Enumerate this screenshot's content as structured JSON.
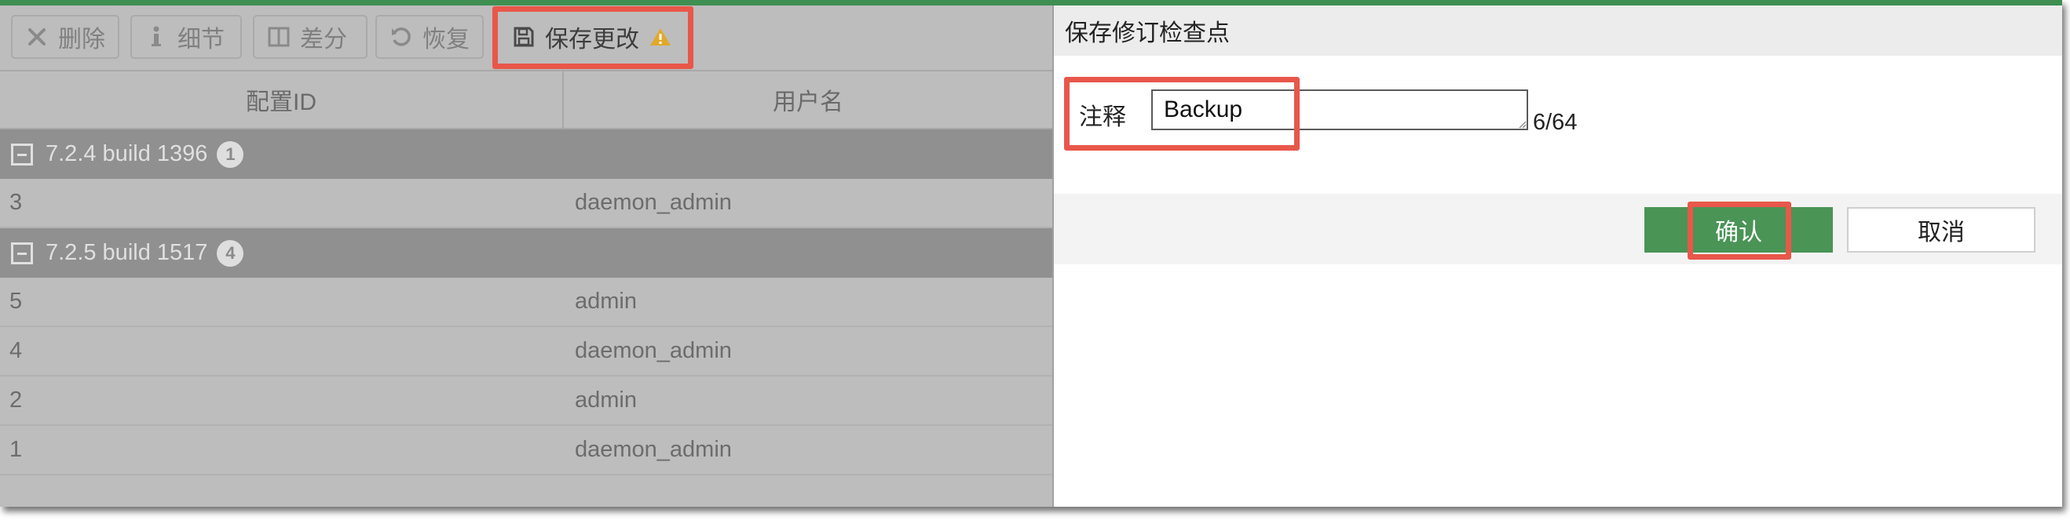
{
  "colors": {
    "accent": "#3f8f52",
    "highlight": "#e8574a",
    "ok_button": "#4a9456",
    "warning": "#e0a92a"
  },
  "toolbar": {
    "delete": {
      "label": "删除",
      "icon": "x-icon"
    },
    "details": {
      "label": "细节",
      "icon": "info-icon"
    },
    "diff": {
      "label": "差分",
      "icon": "split-view-icon"
    },
    "restore": {
      "label": "恢复",
      "icon": "undo-icon"
    },
    "save": {
      "label": "保存更改",
      "icon": "floppy-disk-icon",
      "warning_icon": "warning-triangle-icon"
    }
  },
  "table": {
    "columns": [
      "配置ID",
      "用户名"
    ],
    "groups": [
      {
        "label": "7.2.4 build 1396",
        "count": "1",
        "rows": [
          {
            "id": "3",
            "user": "daemon_admin"
          }
        ]
      },
      {
        "label": "7.2.5 build 1517",
        "count": "4",
        "rows": [
          {
            "id": "5",
            "user": "admin"
          },
          {
            "id": "4",
            "user": "daemon_admin"
          },
          {
            "id": "2",
            "user": "admin"
          },
          {
            "id": "1",
            "user": "daemon_admin"
          }
        ]
      }
    ]
  },
  "dialog": {
    "title": "保存修订检查点",
    "comment_label": "注释",
    "comment_value": "Backup",
    "char_count": "6/64",
    "ok_label": "确认",
    "cancel_label": "取消"
  }
}
